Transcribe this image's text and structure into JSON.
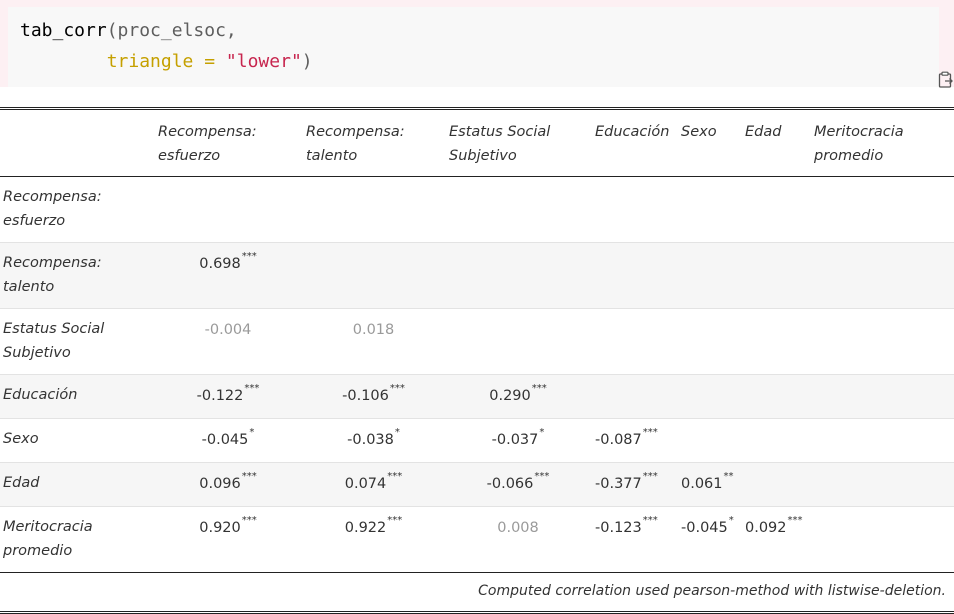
{
  "code": {
    "line1_fn": "tab_corr",
    "line1_paren": "(",
    "line1_arg": "proc_elsoc,",
    "line2_indent": "        ",
    "line2_name": "triangle",
    "line2_op": " = ",
    "line2_str": "\"lower\"",
    "line2_close": ")"
  },
  "copy_icon": "clipboard-copy-icon",
  "table": {
    "headers": [
      "",
      "Recompensa: esfuerzo",
      "Recompensa: talento",
      "Estatus Social Subjetivo",
      "Educación",
      "Sexo",
      "Edad",
      "Meritocracia promedio"
    ],
    "rows": [
      {
        "label": "Recompensa: esfuerzo",
        "cells": []
      },
      {
        "label": "Recompensa: talento",
        "cells": [
          {
            "v": "0.698",
            "s": "***"
          }
        ]
      },
      {
        "label": "Estatus Social Subjetivo",
        "cells": [
          {
            "v": "-0.004",
            "s": "",
            "dim": true
          },
          {
            "v": "0.018",
            "s": "",
            "dim": true
          }
        ]
      },
      {
        "label": "Educación",
        "cells": [
          {
            "v": "-0.122",
            "s": "***"
          },
          {
            "v": "-0.106",
            "s": "***"
          },
          {
            "v": "0.290",
            "s": "***"
          }
        ]
      },
      {
        "label": "Sexo",
        "cells": [
          {
            "v": "-0.045",
            "s": "*"
          },
          {
            "v": "-0.038",
            "s": "*"
          },
          {
            "v": "-0.037",
            "s": "*"
          },
          {
            "v": "-0.087",
            "s": "***"
          }
        ]
      },
      {
        "label": "Edad",
        "cells": [
          {
            "v": "0.096",
            "s": "***"
          },
          {
            "v": "0.074",
            "s": "***"
          },
          {
            "v": "-0.066",
            "s": "***"
          },
          {
            "v": "-0.377",
            "s": "***"
          },
          {
            "v": "0.061",
            "s": "**"
          }
        ]
      },
      {
        "label": "Meritocracia promedio",
        "cells": [
          {
            "v": "0.920",
            "s": "***"
          },
          {
            "v": "0.922",
            "s": "***"
          },
          {
            "v": "0.008",
            "s": "",
            "dim": true
          },
          {
            "v": "-0.123",
            "s": "***"
          },
          {
            "v": "-0.045",
            "s": "*"
          },
          {
            "v": "0.092",
            "s": "***"
          }
        ]
      }
    ],
    "footnote": "Computed correlation used pearson-method with listwise-deletion."
  }
}
